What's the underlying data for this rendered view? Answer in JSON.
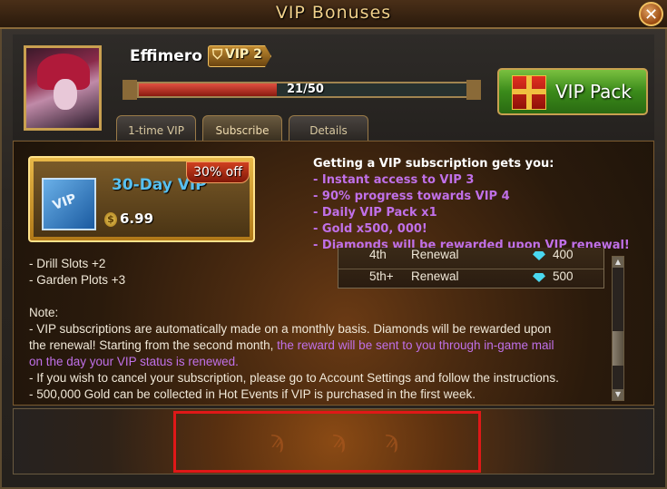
{
  "window": {
    "title": "VIP Bonuses",
    "close_glyph": "✕"
  },
  "player": {
    "name": "Effimero",
    "vip_label": "VIP 2"
  },
  "vip_progress": {
    "current": 21,
    "max": 50,
    "text": "21/50",
    "fraction": 0.42
  },
  "vip_pack_button": {
    "label": "VIP Pack"
  },
  "tabs": [
    {
      "label": "1-time VIP",
      "active": false
    },
    {
      "label": "Subscribe",
      "active": true
    },
    {
      "label": "Details",
      "active": false
    }
  ],
  "product": {
    "title": "30-Day VIP",
    "discount": "30% off",
    "price": "6.99",
    "icon_text": "VIP",
    "currency_glyph": "$"
  },
  "benefits": {
    "heading": "Getting a VIP subscription gets you:",
    "items": [
      "- Instant access to VIP 3",
      "- 90% progress towards VIP 4",
      "- Daily VIP Pack x1",
      "- Gold x500, 000!",
      "- Diamonds will be rewarded upon VIP renewal!"
    ]
  },
  "renewal_table": [
    {
      "tier": "4th",
      "type": "Renewal",
      "diamonds": "400"
    },
    {
      "tier": "5th+",
      "type": "Renewal",
      "diamonds": "500"
    }
  ],
  "content": {
    "line1": "- Drill Slots +2",
    "line2": "- Garden Plots +3",
    "note_heading": "Note:",
    "note1": "- VIP subscriptions are automatically made on a monthly basis. Diamonds will be rewarded upon",
    "note2a": "the renewal! Starting from the second month, ",
    "note2b": "the reward will be sent to you through in-game mail",
    "note3": "on the day your VIP status is renewed.",
    "note4": "- If you wish to cancel your subscription, please go to Account Settings and follow the instructions.",
    "note5": "- 500,000 Gold can be collected in Hot Events if VIP is purchased in the first week."
  },
  "colors": {
    "accent_purple": "#c070e8",
    "title_gold": "#f0d08a",
    "highlight_red": "#e01818"
  },
  "icons": {
    "close": "close-icon",
    "gift": "gift-icon",
    "diamond": "diamond-icon",
    "coin": "coin-icon",
    "ticket": "vip-ticket-icon"
  }
}
